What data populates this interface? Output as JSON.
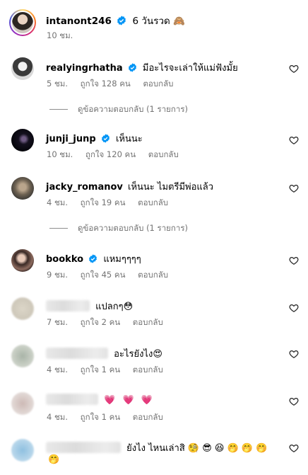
{
  "caption": {
    "username": "intanont246",
    "text": "6 วันรวด",
    "emoji": "🙈",
    "time": "10 ชม."
  },
  "comments": [
    {
      "username": "realyingrhatha",
      "text": "มีอะไรจะเล่าให้แม่ฟังมั้ย",
      "time": "5 ชม.",
      "likes": "ถูกใจ 128 คน",
      "reply": "ตอบกลับ",
      "view_replies": "ดูข้อความตอบกลับ (1 รายการ)"
    },
    {
      "username": "junji_junp",
      "text": "เห็นนะ",
      "time": "10 ชม.",
      "likes": "ถูกใจ 120 คน",
      "reply": "ตอบกลับ"
    },
    {
      "username": "jacky_romanov",
      "text": "เห็นนะ ไมตรีมีพ่อแล้ว",
      "time": "4 ชม.",
      "likes": "ถูกใจ 19 คน",
      "reply": "ตอบกลับ",
      "view_replies": "ดูข้อความตอบกลับ (1 รายการ)"
    },
    {
      "username": "bookko",
      "text": "แหมๆๆๆๆ",
      "time": "9 ชม.",
      "likes": "ถูกใจ 45 คน",
      "reply": "ตอบกลับ"
    },
    {
      "text": "แปลกๆ",
      "emoji": "😳",
      "time": "7 ชม.",
      "likes": "ถูกใจ 2 คน",
      "reply": "ตอบกลับ"
    },
    {
      "text": "อะไรยังไง",
      "emoji": "😍",
      "time": "4 ชม.",
      "likes": "ถูกใจ 1 คน",
      "reply": "ตอบกลับ"
    },
    {
      "text": "",
      "emoji": "💗 💗 💗",
      "time": "4 ชม.",
      "likes": "ถูกใจ 1 คน",
      "reply": "ตอบกลับ"
    },
    {
      "text": "ยังไง ไหนเล่าสิ",
      "emoji": "🧐 😎 😆 🤭 🤭 🤭",
      "emoji_wrap": "🤭"
    }
  ],
  "colors": {
    "text": "#000000",
    "secondary": "#737373",
    "verified": "#0095f6"
  },
  "icons": [
    "verified-badge-icon",
    "heart-outline-icon"
  ]
}
